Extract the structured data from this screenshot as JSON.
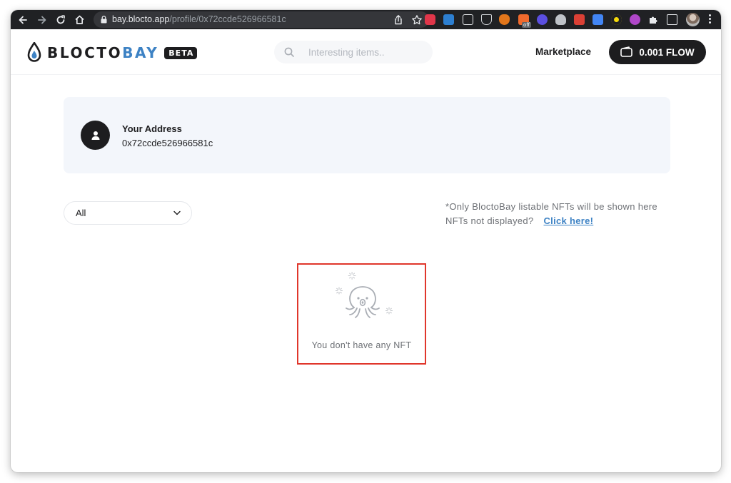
{
  "browser": {
    "url_host": "bay.blocto.app",
    "url_path": "/profile/0x72ccde526966581c",
    "extension_badge": "off"
  },
  "header": {
    "logo_main": "BLOCTO",
    "logo_accent": "BAY",
    "beta_label": "BETA",
    "search_placeholder": "Interesting items..",
    "marketplace_label": "Marketplace",
    "balance_label": "0.001 FLOW"
  },
  "profile": {
    "address_label": "Your Address",
    "address_value": "0x72ccde526966581c"
  },
  "filter": {
    "selected": "All"
  },
  "notice": {
    "line1": "*Only BloctoBay listable NFTs will be shown here",
    "line2": "NFTs not displayed?",
    "link_label": "Click here!"
  },
  "empty_state": {
    "message": "You don't have any NFT"
  },
  "colors": {
    "accent": "#3d82c4",
    "dark": "#1d1d1f",
    "highlight": "#e0362b",
    "card_bg": "#f3f6fb"
  }
}
